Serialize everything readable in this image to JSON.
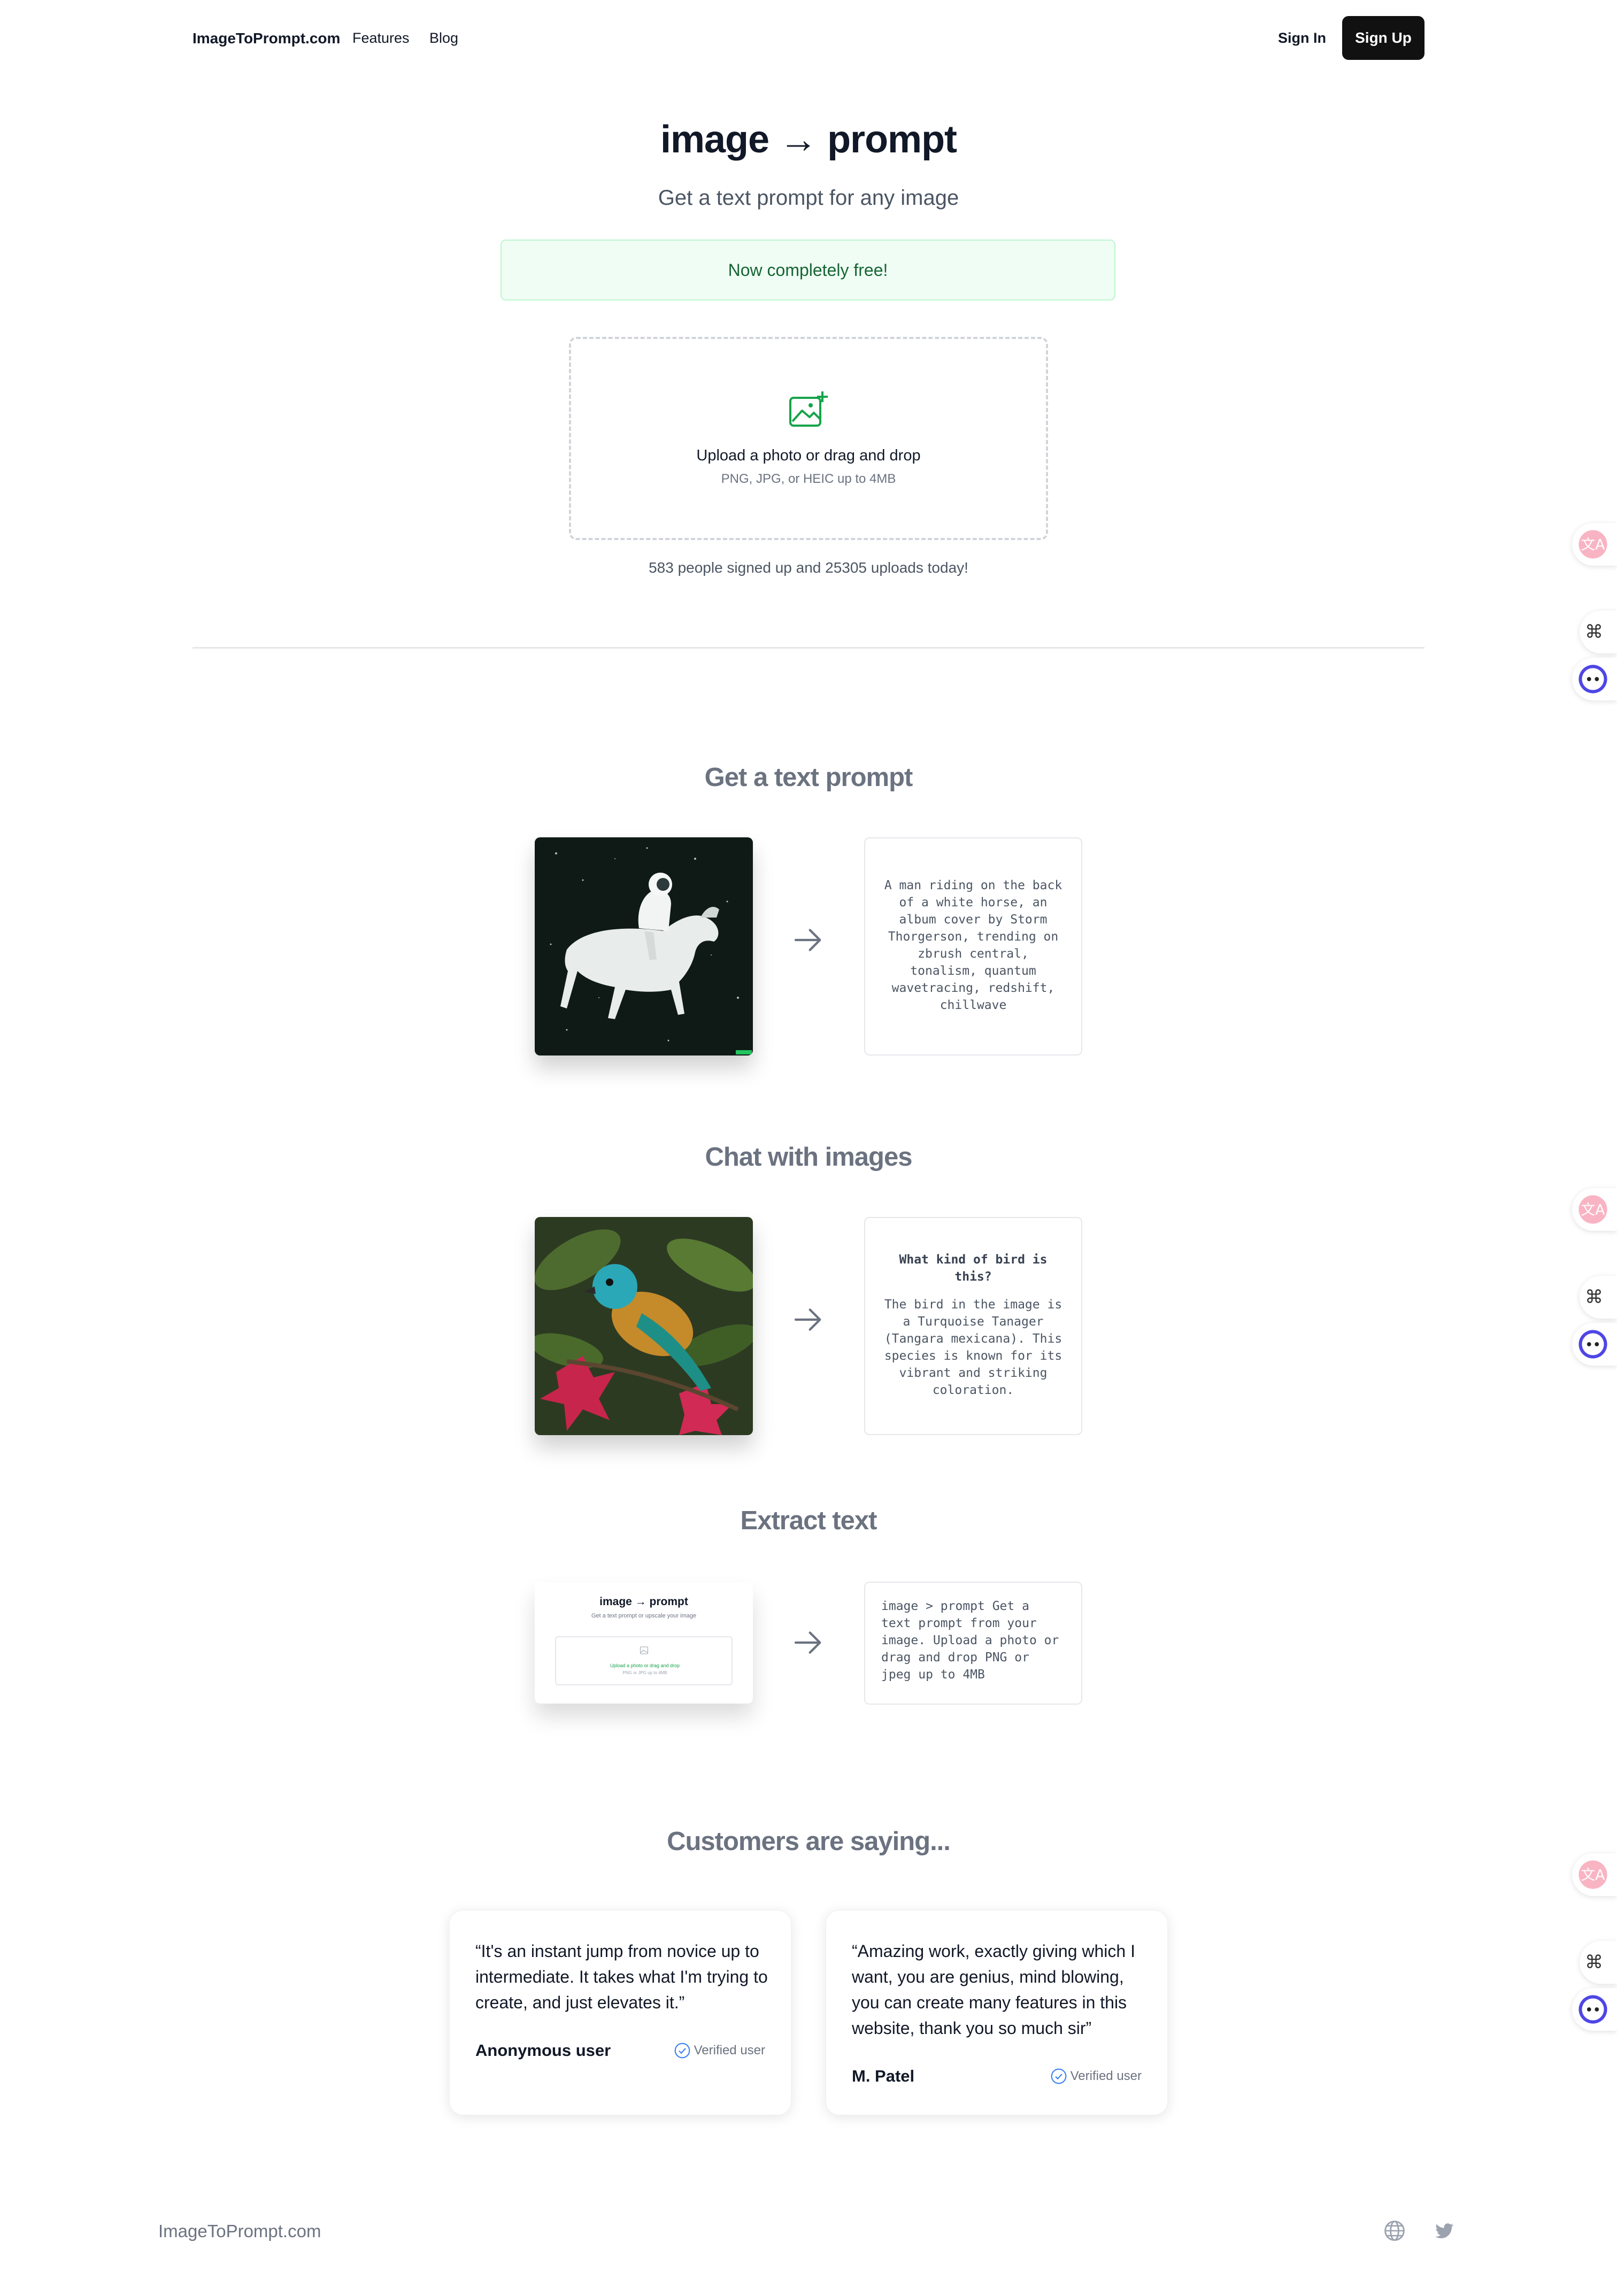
{
  "header": {
    "brand": "ImageToPrompt.com",
    "nav": [
      "Features",
      "Blog"
    ],
    "sign_in": "Sign In",
    "sign_up": "Sign Up"
  },
  "hero": {
    "title": "image → prompt",
    "subtitle": "Get a text prompt for any image",
    "banner": "Now completely free!",
    "upload_label": "Upload a photo or drag and drop",
    "upload_hint": "PNG, JPG, or HEIC up to 4MB",
    "stats": "583 people signed up and 25305 uploads today!"
  },
  "sections": {
    "prompt": {
      "title": "Get a text prompt",
      "output": "A man riding on the back of a white horse, an album cover by Storm Thorgerson, trending on zbrush central, tonalism, quantum wavetracing, redshift, chillwave"
    },
    "chat": {
      "title": "Chat with images",
      "question": "What kind of bird is this?",
      "answer": "The bird in the image is a Turquoise Tanager (Tangara mexicana). This species is known for its vibrant and striking coloration."
    },
    "extract": {
      "title": "Extract text",
      "thumb_title": "image → prompt",
      "thumb_sub": "Get a text prompt or upscale your image",
      "thumb_upload": "Upload a photo or drag and drop",
      "thumb_hint": "PNG or JPG up to 4MB",
      "output": "image > prompt Get a text prompt from your image. Upload a photo or drag and drop PNG or jpeg up to 4MB"
    }
  },
  "testimonials": {
    "title": "Customers are saying...",
    "verified_label": "Verified user",
    "items": [
      {
        "quote": "“It's an instant jump from novice up to intermediate. It takes what I'm trying to create, and just elevates it.”",
        "author": "Anonymous user"
      },
      {
        "quote": "“Amazing work, exactly giving which I want, you are genius, mind blowing, you can create many features in this website, thank you so much sir”",
        "author": "M. Patel"
      }
    ]
  },
  "footer": {
    "brand": "ImageToPrompt.com",
    "icons": [
      "globe-icon",
      "twitter-icon"
    ]
  },
  "colors": {
    "accent_green": "#16a34a",
    "banner_bg": "#f0fdf4",
    "button_dark": "#111111",
    "verified_blue": "#3b82f6"
  }
}
